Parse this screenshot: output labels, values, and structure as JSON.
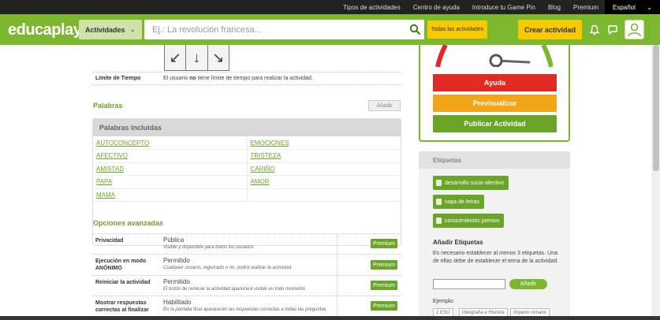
{
  "topnav": {
    "links": [
      "Tipos de actividades",
      "Centro de ayuda",
      "Introduce tu Game Pin",
      "Blog",
      "Premium"
    ],
    "language": "Español"
  },
  "header": {
    "logo": "educaplay",
    "activities_select": "Actividades",
    "search_placeholder": "Ej.: La revolución francesa...",
    "all_activities": "Todas las actividades",
    "create_activity": "Crear actividad"
  },
  "settings": {
    "time_limit_label": "Límite de Tiempo",
    "time_limit_value_pre": "El usuario ",
    "time_limit_value_bold": "no",
    "time_limit_value_post": " tiene límite de tiempo para realizar la actividad."
  },
  "words": {
    "section_title": "Palabras",
    "add_label": "Añadir",
    "included_title": "Palabras incluidas",
    "rows": [
      [
        "AUTOCONCEPTO",
        "EMOCIONES"
      ],
      [
        "AFECTIVO",
        "TRISTEZA"
      ],
      [
        "AMISTAD",
        "CARIÑO"
      ],
      [
        "PAPA",
        "AMOR"
      ],
      [
        "MAMA",
        ""
      ]
    ]
  },
  "advanced": {
    "section_title": "Opciones avanzadas",
    "rows": [
      {
        "label": "Privacidad",
        "value": "Pública",
        "desc": "Visible y disponible para todos los usuarios",
        "badge": "Premium"
      },
      {
        "label": "Ejecución en modo ANÓNIMO",
        "value": "Permitido",
        "desc": "Cualquier usuario, registrado o no, podrá realizar la actividad",
        "badge": "Premium"
      },
      {
        "label": "Reiniciar la actividad",
        "value": "Permitido",
        "desc": "El botón de reiniciar la actividad aparecerá visible en todo momento",
        "badge": "Premium"
      },
      {
        "label": "Mostrar respuestas correctas al finalizar",
        "value": "Habilitado",
        "desc": "En la pantalla final aparecerán las respuestas correctas a todas las preguntas",
        "badge": "Premium"
      }
    ]
  },
  "actions": {
    "help": "Ayuda",
    "preview": "Previsualizar",
    "publish": "Publicar Actividad"
  },
  "tags": {
    "title": "Etiquetas",
    "items": [
      "desarrollo socio afectivo",
      "sopa de letras",
      "conocimientos previos"
    ],
    "add_title": "Añadir Etiquetas",
    "add_text": "Es necesario establecer al menos 3 etiquetas. Una de ellas debe de establecer el tema de la actividad.",
    "add_button": "Añadir",
    "example_label": "Ejemplo:",
    "examples": [
      "1 ESO",
      "Geografía e Historia",
      "Imperio romano"
    ]
  },
  "colors": {
    "brand_green": "#7cb82f",
    "yellow": "#f6c900",
    "red": "#e02b24",
    "orange": "#f3a51a",
    "dark_green": "#6aa528"
  }
}
